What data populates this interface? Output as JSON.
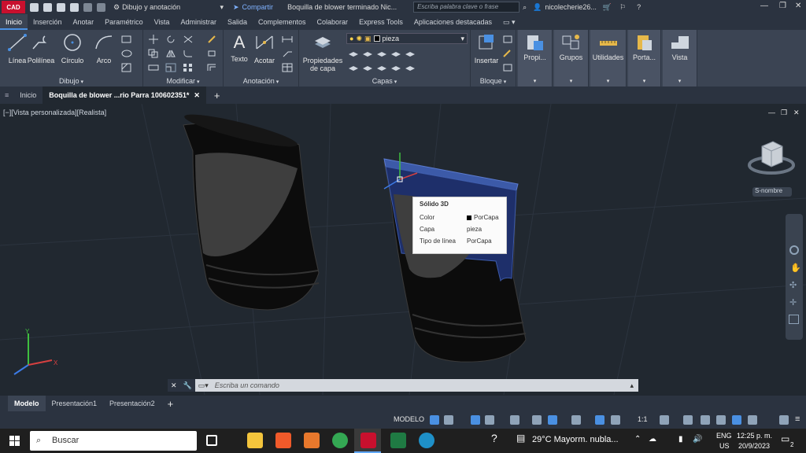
{
  "title_bar": {
    "app_logo": "CAD",
    "workspace": "Dibujo y anotación",
    "share_label": "Compartir",
    "doc_title": "Boquilla de blower terminado Nic...",
    "search_placeholder": "Escriba palabra clave o frase",
    "user": "nicolecherie26...",
    "accent": "#c8102e"
  },
  "ribbon_tabs": [
    "Inicio",
    "Inserción",
    "Anotar",
    "Paramétrico",
    "Vista",
    "Administrar",
    "Salida",
    "Complementos",
    "Colaborar",
    "Express Tools",
    "Aplicaciones destacadas"
  ],
  "ribbon": {
    "draw_panel": {
      "label": "Dibujo",
      "buttons": [
        "Línea",
        "Polilínea",
        "Círculo",
        "Arco"
      ]
    },
    "modify_panel": {
      "label": "Modificar"
    },
    "annotation_panel": {
      "label": "Anotación",
      "buttons": [
        "Texto",
        "Acotar"
      ]
    },
    "layers_panel": {
      "label": "Capas",
      "big_button": "Propiedades de capa",
      "current_layer": "pieza"
    },
    "block_panel": {
      "label": "Bloque",
      "big_button": "Insertar"
    },
    "extra_buttons": [
      "Propi...",
      "Grupos",
      "Utilidades",
      "Porta...",
      "Vista"
    ]
  },
  "doc_tabs": {
    "home": "Inicio",
    "active": "Boquilla de blower ...rio Parra 100602351*"
  },
  "viewport": {
    "label": "[−][Vista personalizada][Realista]",
    "viewcube_label": "S-nombre",
    "tooltip": {
      "title": "Sólido 3D",
      "rows": [
        {
          "key": "Color",
          "value": "PorCapa"
        },
        {
          "key": "Capa",
          "value": "pieza"
        },
        {
          "key": "Tipo de línea",
          "value": "PorCapa"
        }
      ]
    }
  },
  "command_line": {
    "placeholder": "Escriba un comando"
  },
  "layout_tabs": [
    "Modelo",
    "Presentación1",
    "Presentación2"
  ],
  "status_bar": {
    "model_label": "MODELO",
    "scale": "1:1"
  },
  "taskbar": {
    "search_label": "Buscar",
    "weather": "29°C  Mayorm. nubla...",
    "lang": "ENG",
    "region": "US",
    "time": "12:25 p. m.",
    "date": "20/9/2023",
    "notifications": "2"
  }
}
